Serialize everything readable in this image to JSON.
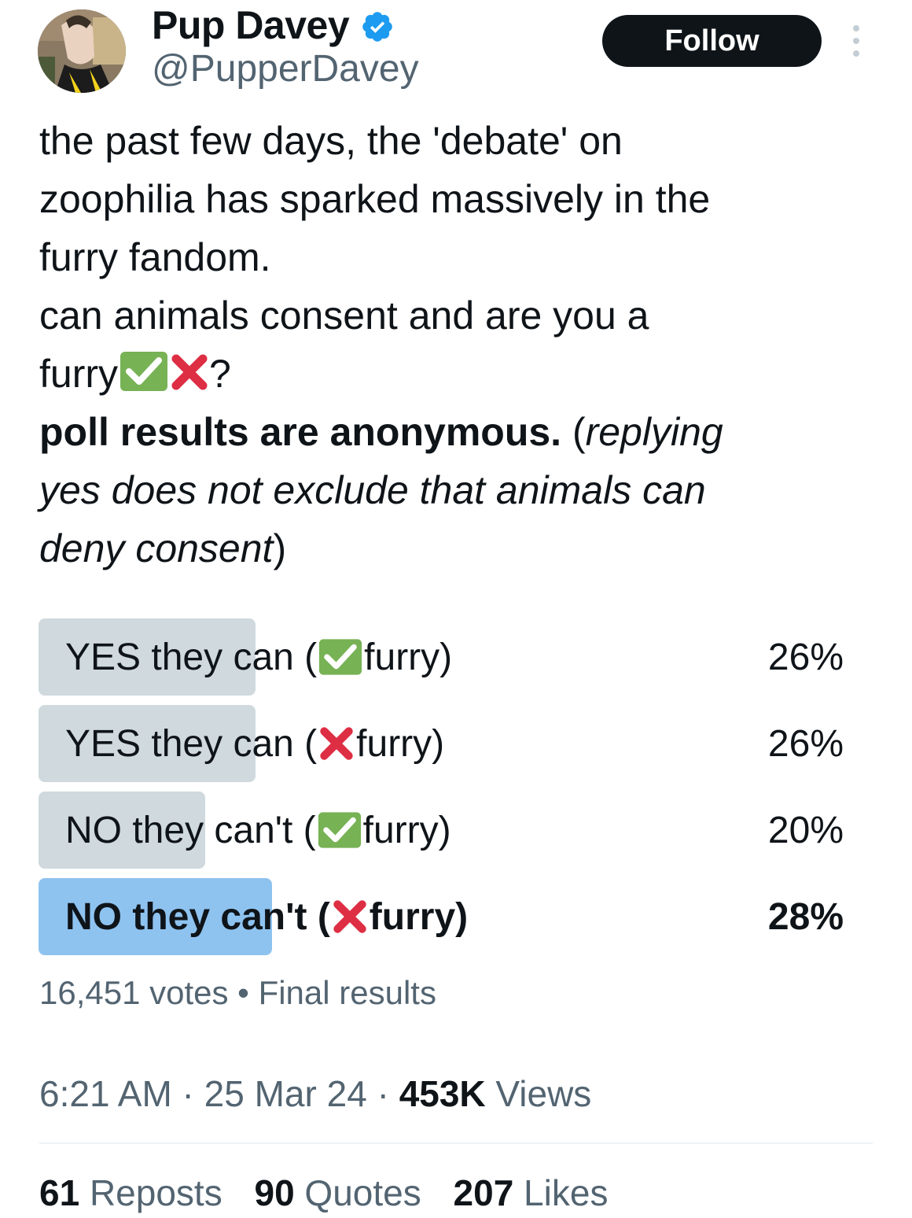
{
  "author": {
    "display_name": "Pup Davey",
    "handle": "@PupperDavey",
    "verified": true
  },
  "follow_label": "Follow",
  "tweet": {
    "line1": "the past few days, the 'debate' on",
    "line2": "zoophilia has sparked massively in the",
    "line3": "furry fandom.",
    "line4": "can animals consent and are you a",
    "line5_text": "furry",
    "line5_end": "?",
    "bold_text": "poll results are anonymous.",
    "paren_open": " (",
    "italic1": "replying",
    "italic2": "yes does not exclude that animals can",
    "italic3": "deny consent",
    "paren_close": ")"
  },
  "poll": {
    "options": [
      {
        "prefix": "YES they can (",
        "icon": "check-emoji",
        "suffix": "furry)",
        "percent": "26%",
        "fraction": 0.27,
        "winner": false
      },
      {
        "prefix": "YES they can (",
        "icon": "cross-emoji",
        "suffix": "furry)",
        "percent": "26%",
        "fraction": 0.27,
        "winner": false
      },
      {
        "prefix": "NO they can't (",
        "icon": "check-emoji",
        "suffix": "furry)",
        "percent": "20%",
        "fraction": 0.207,
        "winner": false
      },
      {
        "prefix": "NO they can't (",
        "icon": "cross-emoji",
        "suffix": "furry)",
        "percent": "28%",
        "fraction": 0.29,
        "winner": true
      }
    ],
    "votes": "16,451 votes",
    "separator": " • ",
    "status": "Final results"
  },
  "meta": {
    "time": "6:21 AM",
    "date": "25 Mar 24",
    "views_count": "453K",
    "views_label": " Views",
    "dot": " · "
  },
  "stats": {
    "reposts_count": "61",
    "reposts_label": " Reposts",
    "quotes_count": "90",
    "quotes_label": " Quotes",
    "likes_count": "207",
    "likes_label": " Likes"
  },
  "colors": {
    "text": "#0f1419",
    "secondary": "#536471",
    "poll_bar": "#cfd9de",
    "poll_winner": "#8ec3f0",
    "verified": "#1d9bf0",
    "follow_bg": "#0f1419"
  }
}
